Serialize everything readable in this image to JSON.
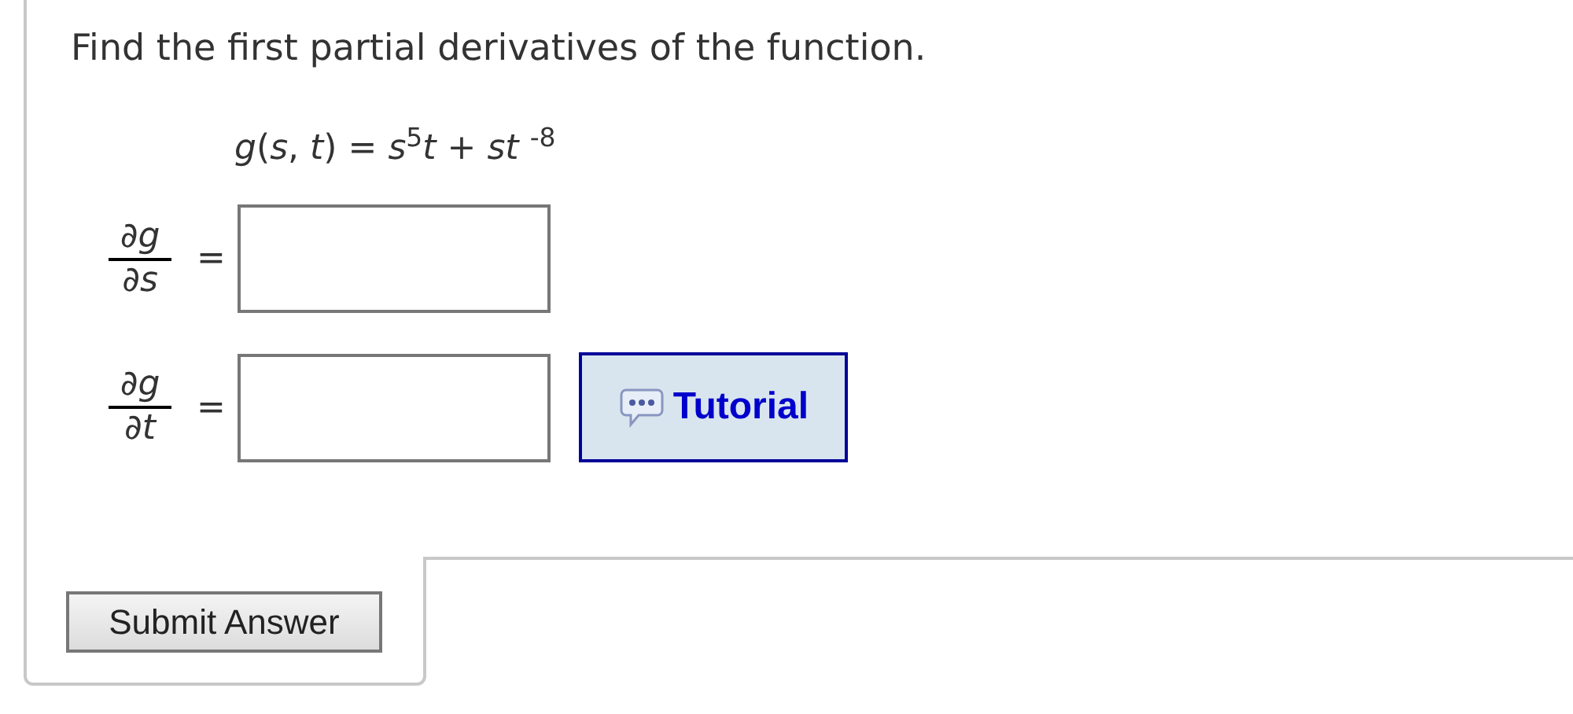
{
  "question": {
    "prompt": "Find the first partial derivatives of the function.",
    "formula": "*g*(*s*, *t*) = *s*$^{5}$*t* + *st* $^{-8}$"
  },
  "answers": [
    {
      "numerator": "∂g",
      "denominator": "∂s",
      "equals": "="
    },
    {
      "numerator": "∂g",
      "denominator": "∂t",
      "equals": "=",
      "tutorial": "Tutorial"
    }
  ],
  "submit": "Submit Answer"
}
